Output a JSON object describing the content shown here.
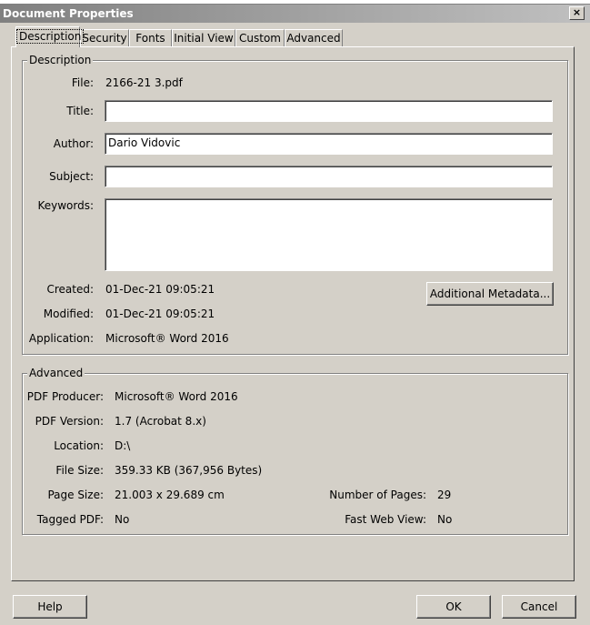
{
  "dialog": {
    "title": "Document Properties",
    "close_glyph": "×"
  },
  "tabs": [
    {
      "label": "Description",
      "active": true
    },
    {
      "label": "Security"
    },
    {
      "label": "Fonts"
    },
    {
      "label": "Initial View"
    },
    {
      "label": "Custom"
    },
    {
      "label": "Advanced"
    }
  ],
  "description": {
    "legend": "Description",
    "file_label": "File:",
    "file_value": "2166-21 3.pdf",
    "title_label": "Title:",
    "title_value": "",
    "author_label": "Author:",
    "author_value": "Dario Vidovic",
    "subject_label": "Subject:",
    "subject_value": "",
    "keywords_label": "Keywords:",
    "keywords_value": "",
    "created_label": "Created:",
    "created_value": "01-Dec-21 09:05:21",
    "modified_label": "Modified:",
    "modified_value": "01-Dec-21 09:05:21",
    "application_label": "Application:",
    "application_value": "Microsoft® Word 2016",
    "metadata_button": "Additional Metadata..."
  },
  "advanced": {
    "legend": "Advanced",
    "producer_label": "PDF Producer:",
    "producer_value": "Microsoft® Word 2016",
    "version_label": "PDF Version:",
    "version_value": "1.7 (Acrobat 8.x)",
    "location_label": "Location:",
    "location_value": "D:\\",
    "filesize_label": "File Size:",
    "filesize_value": "359.33 KB (367,956 Bytes)",
    "pagesize_label": "Page Size:",
    "pagesize_value": "21.003 x 29.689 cm",
    "pages_label": "Number of Pages:",
    "pages_value": "29",
    "tagged_label": "Tagged PDF:",
    "tagged_value": "No",
    "fastweb_label": "Fast Web View:",
    "fastweb_value": "No"
  },
  "buttons": {
    "help": "Help",
    "ok": "OK",
    "cancel": "Cancel"
  }
}
